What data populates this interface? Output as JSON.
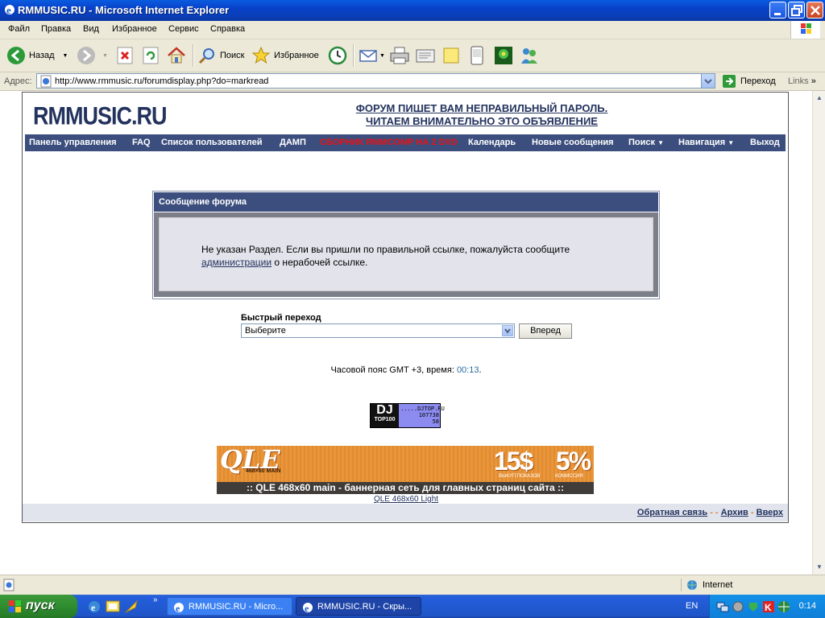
{
  "window": {
    "title": "RMMUSIC.RU - Microsoft Internet Explorer"
  },
  "menu": [
    "Файл",
    "Правка",
    "Вид",
    "Избранное",
    "Сервис",
    "Справка"
  ],
  "toolbar": {
    "back_label": "Назад",
    "search_label": "Поиск",
    "favorites_label": "Избранное"
  },
  "address": {
    "label": "Адрес:",
    "url": "http://www.rmmusic.ru/forumdisplay.php?do=markread",
    "go_label": "Переход",
    "links_label": "Links"
  },
  "page": {
    "logo": "RMMUSIC.RU",
    "announcement_line1": "ФОРУМ ПИШЕТ ВАМ НЕПРАВИЛЬНЫЙ ПАРОЛЬ.",
    "announcement_line2": "ЧИТАЕМ ВНИМАТЕЛЬНО ЭТО ОБЪЯВЛЕНИЕ",
    "nav": [
      {
        "label": "Панель управления"
      },
      {
        "label": "FAQ"
      },
      {
        "label": "Список пользователей"
      },
      {
        "label": "ДАМП"
      },
      {
        "label": "СБОРНИК RMMCOMP НА 2 DVD"
      },
      {
        "label": "Календарь"
      },
      {
        "label": "Новые сообщения"
      },
      {
        "label": "Поиск"
      },
      {
        "label": "Навигация"
      },
      {
        "label": "Выход"
      }
    ],
    "message": {
      "header": "Сообщение форума",
      "text_part1": "Не указан Раздел. Если вы пришли по правильной ссылке, пожалуйста сообщите ",
      "link": "администрации",
      "text_part2": " о нерабочей ссылке."
    },
    "quick_jump": {
      "label": "Быстрый переход",
      "selected": "Выберите",
      "button": "Вперед"
    },
    "timezone": {
      "text": "Часовой пояс GMT +3, время: ",
      "time": "00:13",
      "suffix": "."
    },
    "dj_badge": {
      "logo": "DJ",
      "logo_sub": "TOP100",
      "site": ".....DJTOP.RU",
      "num1": "107738",
      "num2": "58"
    },
    "banner": {
      "brand": "QLE",
      "brand_sub": "468×60 MAIN",
      "price": "15$",
      "price_label": "ВЫКУП ПОКАЗОВ",
      "commission": "5%",
      "commission_label": "КОМИССИЯ",
      "bar_text": ":: QLE 468x60 main - баннерная сеть для главных страниц сайта ::",
      "link": "QLE 468x60 Light"
    },
    "footer": {
      "feedback": "Обратная связь",
      "archive": "Архив",
      "top": "Вверх",
      "sep": "-"
    }
  },
  "status": {
    "zone": "Internet"
  },
  "taskbar": {
    "start": "пуск",
    "tasks": [
      {
        "label": "RMMUSIC.RU - Micro..."
      },
      {
        "label": "RMMUSIC.RU - Скры..."
      }
    ],
    "lang": "EN",
    "clock": "0:14"
  },
  "colors": {
    "nav_bg": "#3b4e7e",
    "logo": "#23335e",
    "nav_red": "#e11111",
    "time": "#2a6fa0"
  }
}
